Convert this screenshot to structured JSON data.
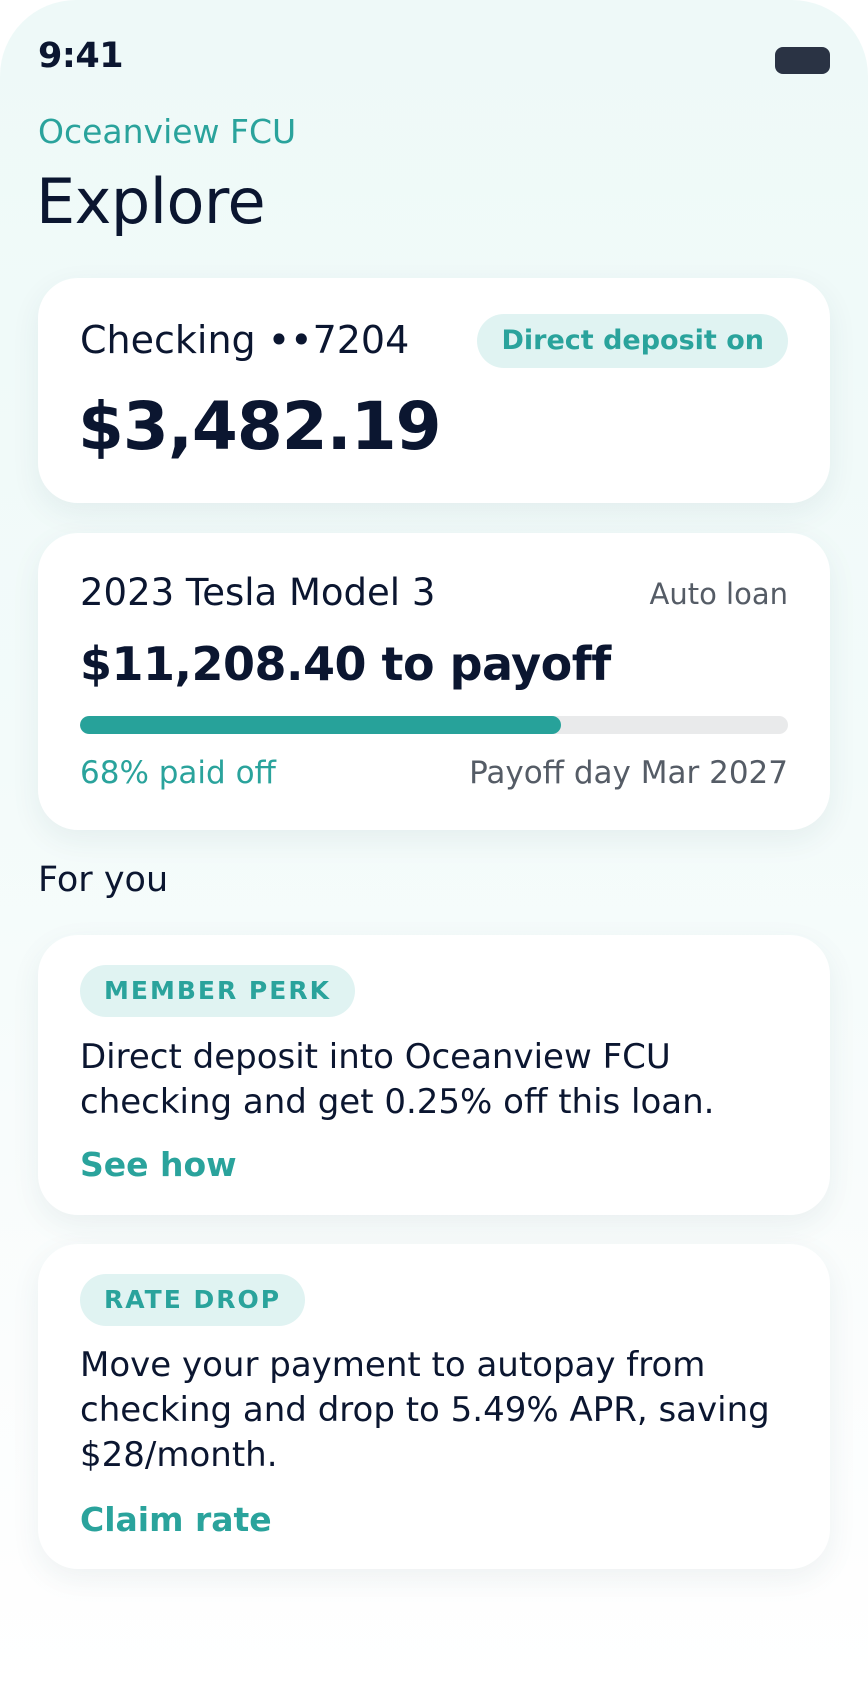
{
  "status_bar": {
    "time": "9:41"
  },
  "header": {
    "brand": "Oceanview FCU",
    "title": "Explore"
  },
  "checking": {
    "label": "Checking ••7204",
    "badge": "Direct deposit on",
    "balance": "$3,482.19"
  },
  "loan": {
    "title": "2023 Tesla Model 3",
    "type": "Auto loan",
    "payoff": "$11,208.40 to payoff",
    "paid_fraction": 0.68,
    "paid_label": "68% paid off",
    "payoff_day": "Payoff day Mar 2027"
  },
  "for_you": {
    "title": "For you",
    "offers": [
      {
        "tag": "MEMBER PERK",
        "text": "Direct deposit into Oceanview FCU checking and get 0.25% off this loan.",
        "link": "See how"
      },
      {
        "tag": "RATE DROP",
        "text": "Move your payment to autopay from checking and drop to 5.49% APR, saving $28/month.",
        "link": "Claim rate"
      }
    ]
  },
  "colors": {
    "accent": "#2aa39c",
    "text": "#0b1630",
    "background": "#eef9f8"
  }
}
